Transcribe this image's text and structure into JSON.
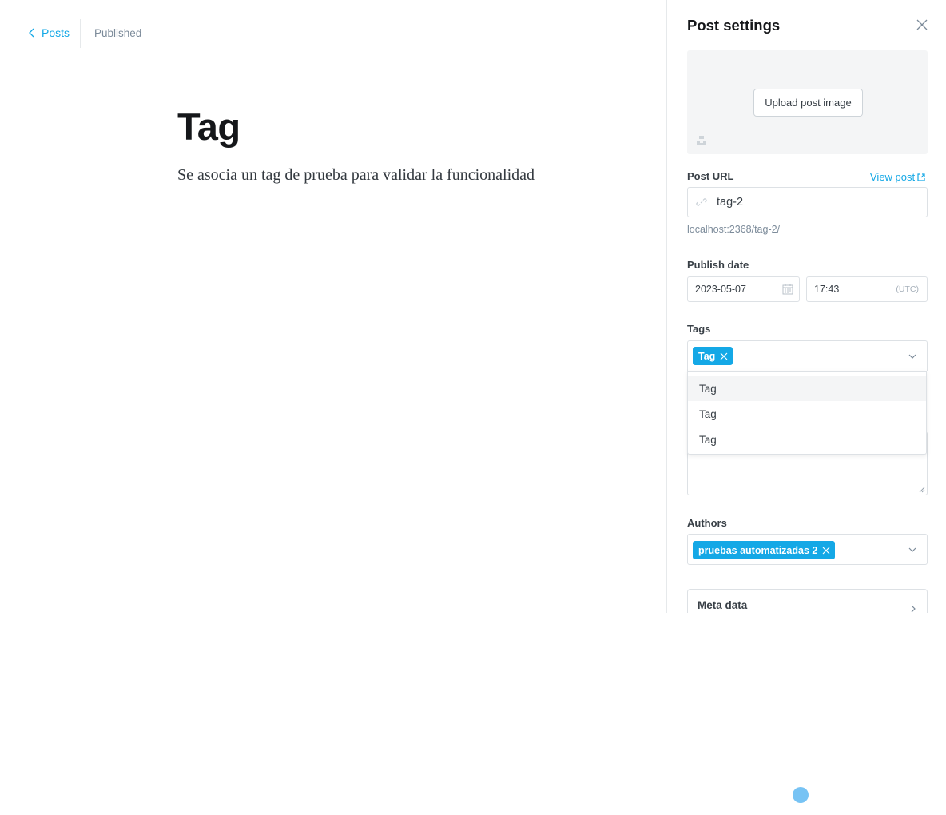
{
  "editor": {
    "back_label": "Posts",
    "status": "Published",
    "title": "Tag",
    "body": "Se asocia un tag de prueba para validar la funcionalidad"
  },
  "settings": {
    "title": "Post settings",
    "upload_label": "Upload post image",
    "post_url": {
      "label": "Post URL",
      "view_post": "View post",
      "value": "tag-2",
      "hint": "localhost:2368/tag-2/"
    },
    "publish": {
      "label": "Publish date",
      "date": "2023-05-07",
      "time": "17:43",
      "timezone": "(UTC)"
    },
    "tags": {
      "label": "Tags",
      "selected": [
        "Tag"
      ],
      "options": [
        "Tag",
        "Tag",
        "Tag"
      ]
    },
    "authors": {
      "label": "Authors",
      "selected": [
        "pruebas automatizadas 2"
      ]
    },
    "meta": {
      "title": "Meta data"
    }
  },
  "colors": {
    "accent": "#14a8e6",
    "text": "#15171a",
    "muted": "#7c8b9a",
    "border": "#dde1e5"
  },
  "icons": [
    "chevron-left-icon",
    "close-icon",
    "unsplash-icon",
    "external-link-icon",
    "link-icon",
    "calendar-icon",
    "chevron-down-icon",
    "token-remove-icon",
    "chevron-right-icon"
  ]
}
